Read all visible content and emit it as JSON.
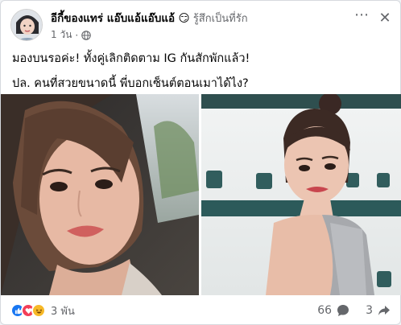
{
  "post": {
    "author": "อีกี้ของแทร่ แอ๊บแอ้แอ๊บแอ้",
    "feeling_emoji": "😏",
    "feeling_text": "รู้สึกเป็นที่รัก",
    "time": "1 วัน",
    "audience_icon": "globe-icon",
    "line1": "มองบนรอค่ะ! ทั้งคู่เลิกติดตาม IG กันสักพักแล้ว!",
    "line2": "ปล. คนที่สวยขนาดนี้ พี่บอกเซ็นต์ตอนเมาได้ไง?"
  },
  "footer": {
    "reaction_count": "3 พัน",
    "comment_count": "66",
    "share_count": "3"
  },
  "colors": {
    "like": "#1877f2",
    "love": "#f33e58",
    "haha": "#f7b928",
    "secondary_text": "#65676b"
  }
}
